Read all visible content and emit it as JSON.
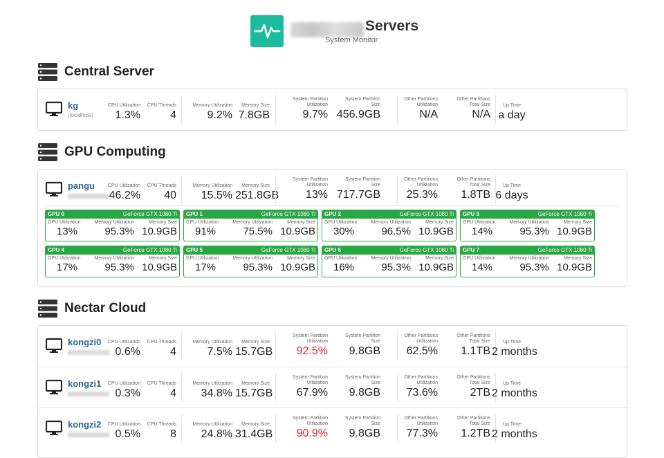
{
  "header": {
    "title": "Servers",
    "subtitle": "System Monitor",
    "logo_icon": "pulse-icon",
    "accent": "#1abc9c"
  },
  "sections": [
    {
      "title": "Central Server",
      "icon": "server-rack-icon"
    },
    {
      "title": "GPU Computing",
      "icon": "server-rack-icon"
    },
    {
      "title": "Nectar Cloud",
      "icon": "server-rack-icon"
    }
  ],
  "labels": {
    "cpu_util": "CPU Utilization",
    "cpu_threads": "CPU Threads",
    "mem_util": "Memory Utilization",
    "mem_size": "Memory Size",
    "sys_util": "System Partition\nUtilization",
    "sys_size": "System Partition\nSize",
    "oth_util": "Other Partitions\nUtilization",
    "oth_size": "Other Partitions\nTotal Size",
    "uptime": "Up Time",
    "gpu_util": "GPU Utilization",
    "gpu_mem_util": "Memory Utilization",
    "gpu_mem_size": "Memory Size"
  },
  "central": {
    "host": "kg",
    "sub": "(localhost)",
    "cpu_util": "1.3%",
    "cpu_threads": "4",
    "mem_util": "9.2%",
    "mem_size": "7.8GB",
    "sys_util": "9.7%",
    "sys_size": "456.9GB",
    "oth_util": "N/A",
    "oth_size": "N/A",
    "uptime": "a day"
  },
  "gpu_server": {
    "host": "pangu",
    "cpu_util": "46.2%",
    "cpu_threads": "40",
    "mem_util": "15.5%",
    "mem_size": "251.8GB",
    "sys_util": "13%",
    "sys_size": "717.7GB",
    "oth_util": "25.3%",
    "oth_size": "1.8TB",
    "uptime": "6 days",
    "gpus": [
      {
        "name": "GPU 0",
        "model": "GeForce GTX 1080 Ti",
        "util": "13%",
        "mem_util": "95.3%",
        "mem_size": "10.9GB"
      },
      {
        "name": "GPU 1",
        "model": "GeForce GTX 1080 Ti",
        "util": "91%",
        "mem_util": "75.5%",
        "mem_size": "10.9GB"
      },
      {
        "name": "GPU 2",
        "model": "GeForce GTX 1080 Ti",
        "util": "30%",
        "mem_util": "96.5%",
        "mem_size": "10.9GB"
      },
      {
        "name": "GPU 3",
        "model": "GeForce GTX 1080 Ti",
        "util": "14%",
        "mem_util": "95.3%",
        "mem_size": "10.9GB"
      },
      {
        "name": "GPU 4",
        "model": "GeForce GTX 1080 Ti",
        "util": "17%",
        "mem_util": "95.3%",
        "mem_size": "10.9GB"
      },
      {
        "name": "GPU 5",
        "model": "GeForce GTX 1080 Ti",
        "util": "17%",
        "mem_util": "95.3%",
        "mem_size": "10.9GB"
      },
      {
        "name": "GPU 6",
        "model": "GeForce GTX 1080 Ti",
        "util": "16%",
        "mem_util": "95.3%",
        "mem_size": "10.9GB"
      },
      {
        "name": "GPU 7",
        "model": "GeForce GTX 1080 Ti",
        "util": "14%",
        "mem_util": "95.3%",
        "mem_size": "10.9GB"
      }
    ]
  },
  "cloud": [
    {
      "host": "kongzi0",
      "cpu_util": "0.6%",
      "cpu_threads": "4",
      "mem_util": "7.5%",
      "mem_size": "15.7GB",
      "sys_util": "92.5%",
      "sys_size": "9.8GB",
      "oth_util": "62.5%",
      "oth_size": "1.1TB",
      "uptime": "2 months"
    },
    {
      "host": "kongzi1",
      "cpu_util": "0.3%",
      "cpu_threads": "4",
      "mem_util": "34.8%",
      "mem_size": "15.7GB",
      "sys_util": "67.9%",
      "sys_size": "9.8GB",
      "oth_util": "73.6%",
      "oth_size": "2TB",
      "uptime": "2 months"
    },
    {
      "host": "kongzi2",
      "cpu_util": "0.5%",
      "cpu_threads": "8",
      "mem_util": "24.8%",
      "mem_size": "31.4GB",
      "sys_util": "90.9%",
      "sys_size": "9.8GB",
      "oth_util": "77.3%",
      "oth_size": "1.2TB",
      "uptime": "2 months"
    }
  ],
  "colors": {
    "warning": "#d62728",
    "gpu_green": "#29a745",
    "link": "#2a6496"
  }
}
